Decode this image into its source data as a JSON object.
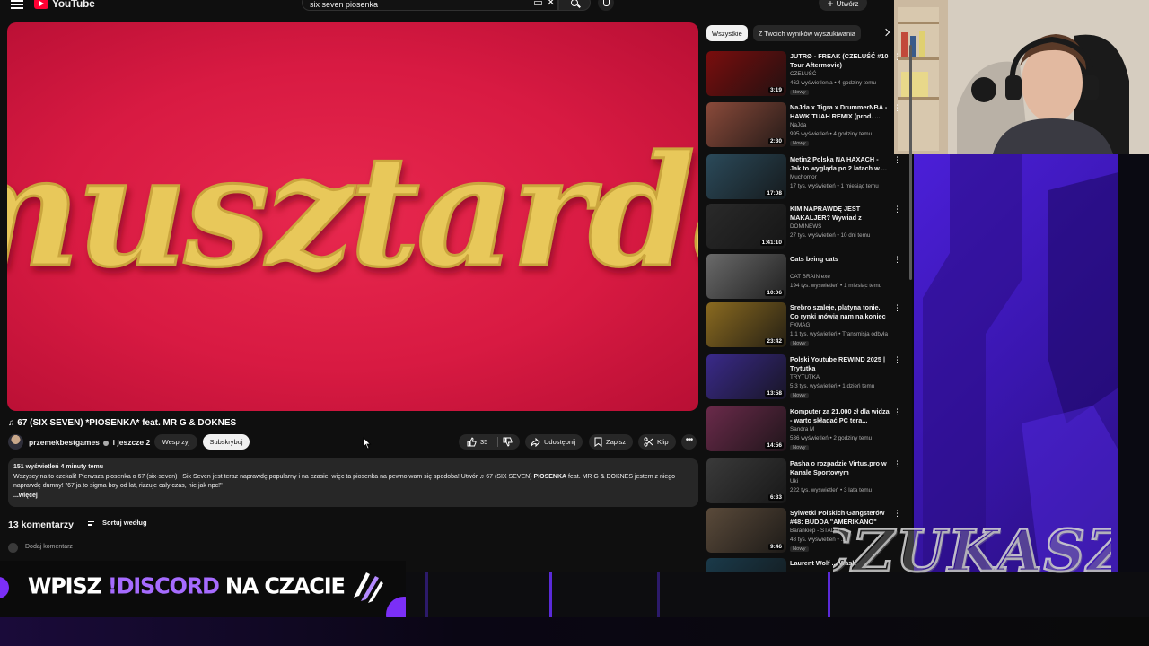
{
  "header": {
    "logo_text": "YouTube",
    "search_value": "six seven piosenka",
    "create_label": "Utwórz"
  },
  "video": {
    "thumbnail_text": "musztarda",
    "title": "♫ 67 (SIX SEVEN) *PIOSENKA* feat. MR G & DOKNES",
    "channel_line": "przemekbestgames",
    "channel_extra": "i jeszcze 2",
    "support_label": "Wesprzyj",
    "subscribe_label": "Subskrybuj",
    "likes": "35",
    "share_label": "Udostępnij",
    "save_label": "Zapisz",
    "clip_label": "Klip"
  },
  "description": {
    "meta": "151 wyświetleń  4 minuty temu",
    "text_part1": "Wszyscy na to czekali! Pierwsza piosenka o 67 (six-seven) ! Six Seven jest teraz naprawdę popularny i na czasie, więc ta piosenka na pewno wam się spodoba! Utwór ♫ 67 (SIX SEVEN) ",
    "text_bold": "PIOSENKA",
    "text_part2": " feat. MR G & DOKNES  jestem z niego naprawdę dumny! \"67 ja to sigma boy od lat, rizzuje cały czas, nie jak npc!\"",
    "more": "...więcej"
  },
  "comments": {
    "count_label": "13 komentarzy",
    "sort_label": "Sortuj według",
    "add_placeholder": "Dodaj komentarz"
  },
  "banner": {
    "part1": "WPISZ ",
    "part2": "!DISCORD",
    "part3": " NA CZACIE"
  },
  "chips": [
    "Wszystkie",
    "Z Twoich wyników wyszukiwania"
  ],
  "related": [
    {
      "title": "JUTRØ - FREAK (CZELUŚĆ #10 Tour Aftermovie)",
      "channel": "CZELUŚĆ",
      "meta": "462 wyświetlenia • 4 godziny temu",
      "badge": "Nowy",
      "duration": "3:19",
      "color": "#7a0d0d"
    },
    {
      "title": "NaJda x Tigra x DrummerNBA - HAWK TUAH REMIX (prod. ...",
      "channel": "NaJda",
      "meta": "995 wyświetleń • 4 godziny temu",
      "badge": "Nowy",
      "duration": "2:30",
      "color": "#8a4a3a"
    },
    {
      "title": "Metin2 Polska NA HAXACH - Jak to wygląda po 2 latach w ...",
      "channel": "Muchomor",
      "meta": "17 tys. wyświetleń • 1 miesiąc temu",
      "badge": "",
      "duration": "17:08",
      "color": "#2b4a5a"
    },
    {
      "title": "KIM NAPRAWDĘ JEST MAKALJER? Wywiad z Legend...",
      "channel": "DOMINEWS",
      "meta": "27 tys. wyświetleń • 10 dni temu",
      "badge": "",
      "duration": "1:41:10",
      "color": "#2a2a2a"
    },
    {
      "title": "Cats being cats",
      "channel": "CAT BRAIN exe",
      "meta": "194 tys. wyświetleń • 1 miesiąc temu",
      "badge": "",
      "duration": "10:06",
      "color": "#6a6a6a"
    },
    {
      "title": "Srebro szaleje, platyna tonie. Co rynki mówią nam na koniec ...",
      "channel": "FXMAG",
      "meta": "1,1 tys. wyświetleń • Transmisja odbyła ...",
      "badge": "Nowy",
      "duration": "23:42",
      "color": "#8a6a20"
    },
    {
      "title": "Polski Youtube REWIND 2025 | Trytutka",
      "channel": "TRYTUTKA",
      "meta": "5,3 tys. wyświetleń • 1 dzień temu",
      "badge": "Nowy",
      "duration": "13:58",
      "color": "#3a2a8a"
    },
    {
      "title": "Komputer za 21.000 zł dla widza - warto składać PC tera...",
      "channel": "Sandra M",
      "meta": "536 wyświetleń • 2 godziny temu",
      "badge": "Nowy",
      "duration": "14:56",
      "color": "#6a2a4a"
    },
    {
      "title": "Pasha o rozpadzie Virtus.pro w Kanale Sportowym",
      "channel": "Uki",
      "meta": "222 tys. wyświetleń • 3 lata temu",
      "badge": "",
      "duration": "6:33",
      "color": "#3a3a3a"
    },
    {
      "title": "Sylwetki Polskich Gangsterów #48: BUDDA \"AMERIKANO\" cz.5",
      "channel": "Barankiep - STADO",
      "meta": "48 tys. wyświetleń • ...",
      "badge": "Nowy",
      "duration": "9:46",
      "color": "#5a4a3a"
    },
    {
      "title": "Laurent Wolf ... Wash",
      "channel": "",
      "meta": "",
      "badge": "",
      "duration": "",
      "color": "#1a3a4a"
    }
  ],
  "overlay": {
    "signature": "CZUKASZ"
  },
  "colors": {
    "accent": "#ff0033",
    "thumbnail_red": "#d81a42",
    "mustard": "#e6c65a",
    "stream_purple": "#4b1fd8"
  }
}
